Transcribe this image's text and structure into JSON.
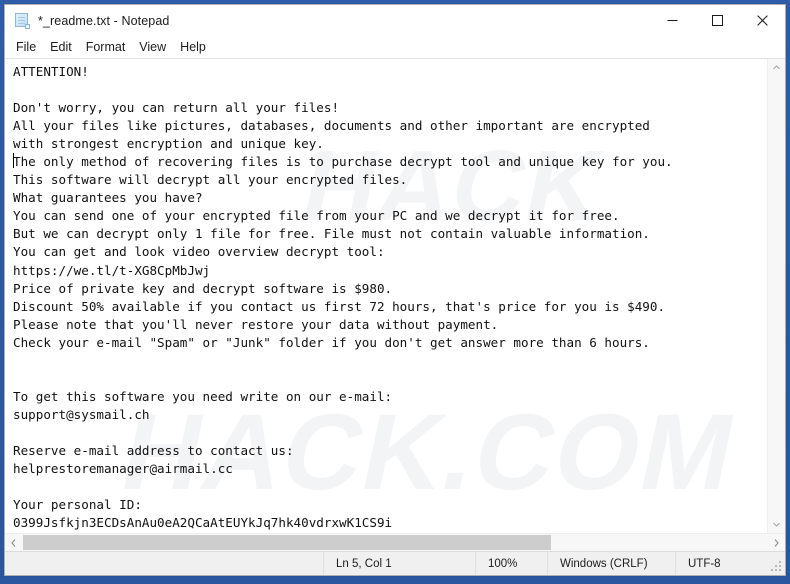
{
  "window": {
    "title": "*_readme.txt - Notepad",
    "icon": "notepad-document-icon",
    "accent_border": "#2e5ca8",
    "controls": {
      "minimize": "minimize-icon",
      "maximize": "maximize-icon",
      "close": "close-icon"
    }
  },
  "menu": {
    "items": [
      {
        "label": "File"
      },
      {
        "label": "Edit"
      },
      {
        "label": "Format"
      },
      {
        "label": "View"
      },
      {
        "label": "Help"
      }
    ]
  },
  "editor": {
    "content": "ATTENTION!\n\nDon't worry, you can return all your files!\nAll your files like pictures, databases, documents and other important are encrypted\nwith strongest encryption and unique key.\nThe only method of recovering files is to purchase decrypt tool and unique key for you.\nThis software will decrypt all your encrypted files.\nWhat guarantees you have?\nYou can send one of your encrypted file from your PC and we decrypt it for free.\nBut we can decrypt only 1 file for free. File must not contain valuable information.\nYou can get and look video overview decrypt tool:\nhttps://we.tl/t-XG8CpMbJwj\nPrice of private key and decrypt software is $980.\nDiscount 50% available if you contact us first 72 hours, that's price for you is $490.\nPlease note that you'll never restore your data without payment.\nCheck your e-mail \"Spam\" or \"Junk\" folder if you don't get answer more than 6 hours.\n\n\nTo get this software you need write on our e-mail:\nsupport@sysmail.ch\n\nReserve e-mail address to contact us:\nhelprestoremanager@airmail.cc\n\nYour personal ID:\n0399Jsfkjn3ECDsAnAu0eA2QCaAtEUYkJq7hk40vdrxwK1CS9i",
    "ransom_details": {
      "video_overview_url": "https://we.tl/t-XG8CpMbJwj",
      "price": "$980",
      "discount_price": "$490",
      "discount_percent": "50%",
      "discount_window_hours": "72",
      "response_time_hours": "6",
      "free_decrypt_files": "1",
      "primary_email": "support@sysmail.ch",
      "reserve_email": "helprestoremanager@airmail.cc",
      "personal_id": "0399Jsfkjn3ECDsAnAu0eA2QCaAtEUYkJq7hk40vdrxwK1CS9i"
    },
    "watermark": {
      "line1": "HACK",
      "line2": "HACK.COM"
    }
  },
  "scrollbars": {
    "vertical": {
      "up_arrow": "chevron-up-icon",
      "down_arrow": "chevron-down-icon"
    },
    "horizontal": {
      "left_arrow": "chevron-left-icon",
      "right_arrow": "chevron-right-icon"
    }
  },
  "statusbar": {
    "position": "Ln 5, Col 1",
    "zoom": "100%",
    "line_endings": "Windows (CRLF)",
    "encoding": "UTF-8"
  }
}
